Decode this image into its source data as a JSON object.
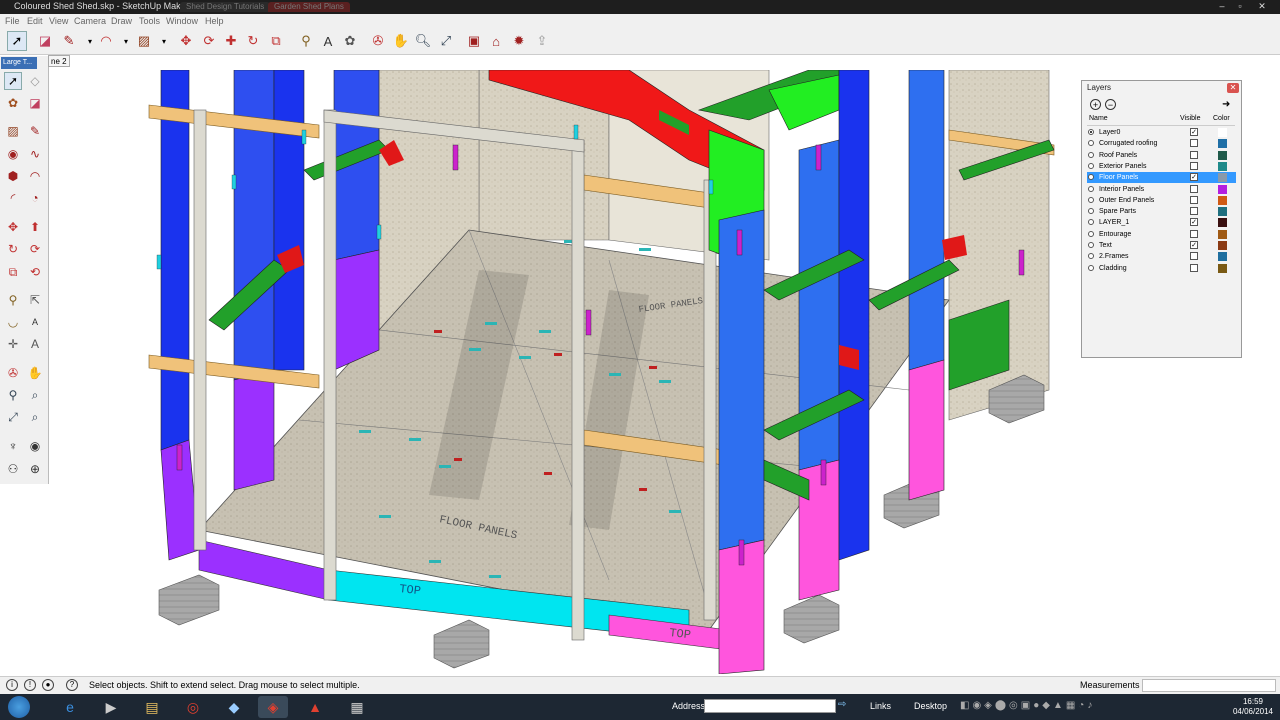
{
  "window": {
    "title": "Coloured Shed Shed.skp - SketchUp Make",
    "ghost_tabs": [
      "Shed Design Tutorials",
      "Garden Shed Plans"
    ]
  },
  "menu": [
    "File",
    "Edit",
    "View",
    "Camera",
    "Draw",
    "Tools",
    "Window",
    "Help"
  ],
  "toolbar": {
    "tools": [
      "select-icon",
      "eraser-icon",
      "pencil-icon",
      "arc-icon",
      "rectangle-icon",
      "push-pull-icon",
      "follow-me-icon",
      "move-icon",
      "rotate-icon",
      "scale-icon",
      "tape-icon",
      "text-icon",
      "paint-icon",
      "orbit-icon",
      "pan-icon",
      "zoom-icon",
      "zoom-extents-icon",
      "components-icon",
      "3d-warehouse-icon",
      "extension-icon",
      "share-icon"
    ]
  },
  "scene_tab": "ne 2",
  "left_panel": {
    "title": "Large T..."
  },
  "layers_panel": {
    "title": "Layers",
    "columns": {
      "name": "Name",
      "visible": "Visible",
      "color": "Color"
    },
    "rows": [
      {
        "name": "Layer0",
        "active": true,
        "visible": true,
        "color": "#ffffff",
        "selected": false
      },
      {
        "name": "Corrugated roofing",
        "active": false,
        "visible": false,
        "color": "#1f6fa6",
        "selected": false
      },
      {
        "name": "Roof Panels",
        "active": false,
        "visible": false,
        "color": "#1f5a4a",
        "selected": false
      },
      {
        "name": "Exterior Panels",
        "active": false,
        "visible": false,
        "color": "#1f8a8a",
        "selected": false
      },
      {
        "name": "Floor Panels",
        "active": false,
        "visible": true,
        "color": "#8899aa",
        "selected": true
      },
      {
        "name": "Interior Panels",
        "active": false,
        "visible": false,
        "color": "#b31fe0",
        "selected": false
      },
      {
        "name": "Outer End Panels",
        "active": false,
        "visible": false,
        "color": "#d05a14",
        "selected": false
      },
      {
        "name": "Spare Parts",
        "active": false,
        "visible": false,
        "color": "#1f6f7f",
        "selected": false
      },
      {
        "name": "LAYER_1",
        "active": false,
        "visible": true,
        "color": "#3a1010",
        "selected": false
      },
      {
        "name": "Entourage",
        "active": false,
        "visible": false,
        "color": "#a05a14",
        "selected": false
      },
      {
        "name": "Text",
        "active": false,
        "visible": true,
        "color": "#8a3a14",
        "selected": false
      },
      {
        "name": "2.Frames",
        "active": false,
        "visible": false,
        "color": "#1f6f9f",
        "selected": false
      },
      {
        "name": "Cladding",
        "active": false,
        "visible": false,
        "color": "#7a5a14",
        "selected": false
      }
    ]
  },
  "status": {
    "message": "Select objects. Shift to extend select. Drag mouse to select multiple.",
    "measurements_label": "Measurements",
    "measurements_value": ""
  },
  "taskbar": {
    "address_label": "Address",
    "links_label": "Links",
    "desktop_label": "Desktop",
    "time": "16:59",
    "date": "04/06/2014"
  },
  "scene_text": {
    "floor_label_1": "FLOOR PANELS",
    "floor_label_2": "FLOOR PANELS",
    "top_label_1": "TOP",
    "top_label_2": "TOP"
  }
}
